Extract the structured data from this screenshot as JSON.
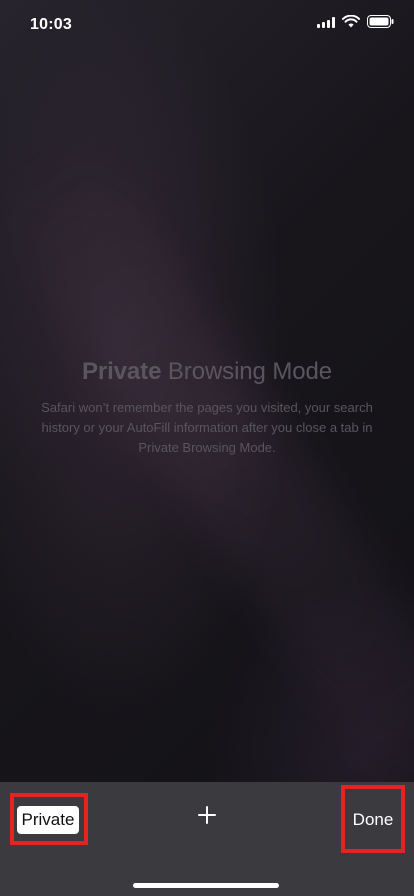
{
  "status_bar": {
    "time": "10:03",
    "icons": {
      "signal": "cellular-signal-icon",
      "wifi": "wifi-icon",
      "battery": "battery-icon"
    }
  },
  "private_mode": {
    "title_strong": "Private",
    "title_rest": " Browsing Mode",
    "description": "Safari won’t remember the pages you visited, your search history or your AutoFill information after you close a tab in Private Browsing Mode."
  },
  "toolbar": {
    "private_label": "Private",
    "new_tab_icon": "plus-icon",
    "done_label": "Done"
  },
  "colors": {
    "toolbar_bg": "#3b3a3f",
    "highlight": "#e1271d",
    "muted_text": "#59565f"
  }
}
